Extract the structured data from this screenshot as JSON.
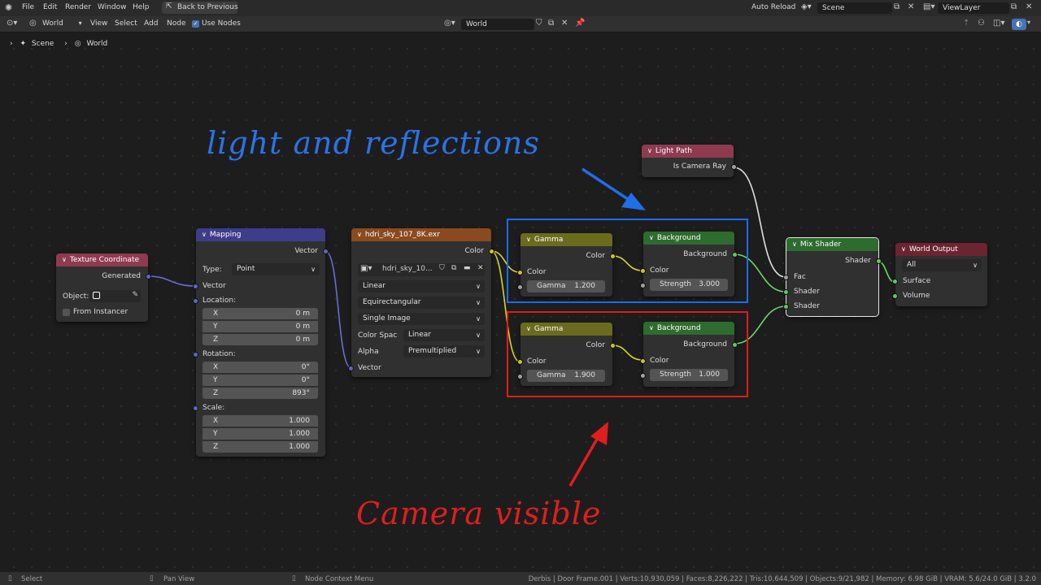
{
  "menu": {
    "items": [
      "File",
      "Edit",
      "Render",
      "Window",
      "Help"
    ],
    "back_btn": "Back to Previous",
    "auto_reload": "Auto Reload",
    "scene": "Scene",
    "view_layer": "ViewLayer"
  },
  "editor_header": {
    "world_type": "World",
    "view": "View",
    "select": "Select",
    "add": "Add",
    "node": "Node",
    "use_nodes": "Use Nodes",
    "world_name": "World"
  },
  "breadcrumb": {
    "scene": "Scene",
    "world": "World"
  },
  "annotations": {
    "top": "light and reflections",
    "bottom": "Camera visible"
  },
  "colors": {
    "blue_box": "#1a6df0",
    "red_box": "#e01c1c",
    "annot_blue": "#2a73e8",
    "annot_red": "#e01e1e"
  },
  "nodes": {
    "texcoord": {
      "title": "Texture Coordinate",
      "out": "Generated",
      "object_label": "Object:",
      "from_instancer": "From Instancer"
    },
    "mapping": {
      "title": "Mapping",
      "out": "Vector",
      "type_label": "Type:",
      "type_value": "Point",
      "vector_in": "Vector",
      "location": "Location:",
      "rotation": "Rotation:",
      "scale": "Scale:",
      "loc": [
        {
          "k": "X",
          "v": "0 m"
        },
        {
          "k": "Y",
          "v": "0 m"
        },
        {
          "k": "Z",
          "v": "0 m"
        }
      ],
      "rot": [
        {
          "k": "X",
          "v": "0°"
        },
        {
          "k": "Y",
          "v": "0°"
        },
        {
          "k": "Z",
          "v": "893°"
        }
      ],
      "scl": [
        {
          "k": "X",
          "v": "1.000"
        },
        {
          "k": "Y",
          "v": "1.000"
        },
        {
          "k": "Z",
          "v": "1.000"
        }
      ]
    },
    "image": {
      "title": "hdri_sky_107_8K.exr",
      "out": "Color",
      "image_name": "hdri_sky_10...",
      "interpolation": "Linear",
      "projection": "Equirectangular",
      "source": "Single Image",
      "color_space_label": "Color Spac",
      "color_space": "Linear",
      "alpha_label": "Alpha",
      "alpha": "Premultiplied",
      "vector_in": "Vector"
    },
    "gamma1": {
      "title": "Gamma",
      "out": "Color",
      "in": "Color",
      "gamma_label": "Gamma",
      "gamma": "1.200"
    },
    "gamma2": {
      "title": "Gamma",
      "out": "Color",
      "in": "Color",
      "gamma_label": "Gamma",
      "gamma": "1.900"
    },
    "bg1": {
      "title": "Background",
      "out": "Background",
      "in": "Color",
      "strength_label": "Strength",
      "strength": "3.000"
    },
    "bg2": {
      "title": "Background",
      "out": "Background",
      "in": "Color",
      "strength_label": "Strength",
      "strength": "1.000"
    },
    "lightpath": {
      "title": "Light Path",
      "out": "Is Camera Ray"
    },
    "mix": {
      "title": "Mix Shader",
      "out": "Shader",
      "fac": "Fac",
      "shader1": "Shader",
      "shader2": "Shader"
    },
    "output": {
      "title": "World Output",
      "target": "All",
      "surface": "Surface",
      "volume": "Volume"
    }
  },
  "status": {
    "select": "Select",
    "pan": "Pan View",
    "context": "Node Context Menu",
    "stats": "Derbis | Door Frame.001 | Verts:10,930,059 | Faces:8,226,222 | Tris:10,644,509 | Objects:9/21,982 | Memory: 6.98 GiB | VRAM: 5.6/24.0 GiB | 3.2.0"
  }
}
